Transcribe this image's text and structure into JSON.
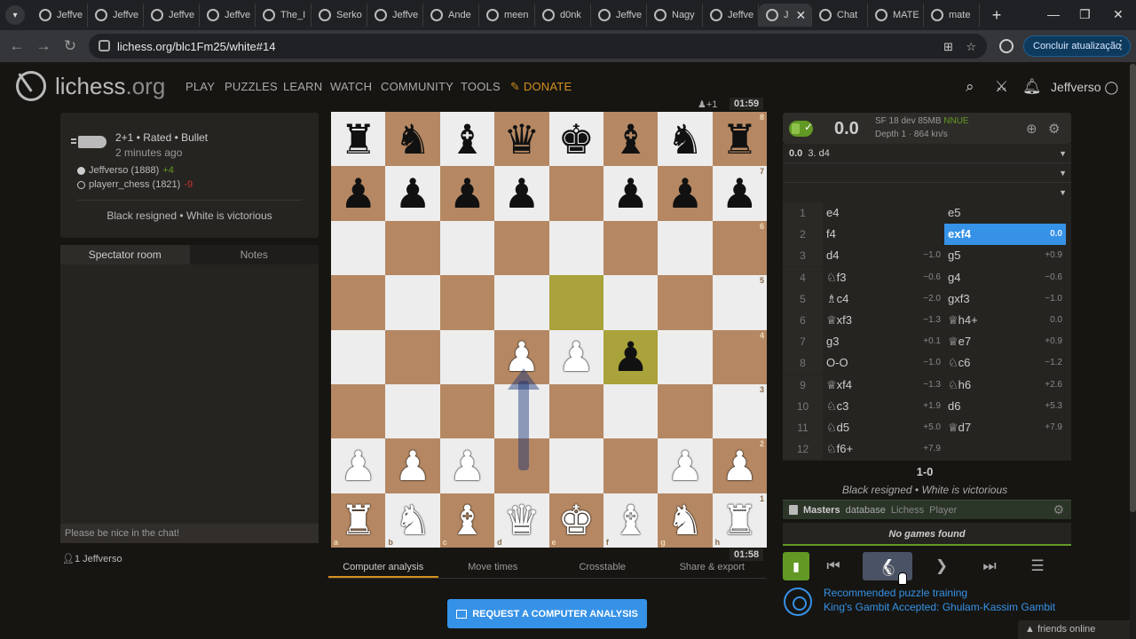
{
  "browser": {
    "tabs": [
      {
        "title": "Jeffve",
        "active": false
      },
      {
        "title": "Jeffve",
        "active": false
      },
      {
        "title": "Jeffve",
        "active": false
      },
      {
        "title": "Jeffve",
        "active": false
      },
      {
        "title": "The_I",
        "active": false
      },
      {
        "title": "Serko",
        "active": false
      },
      {
        "title": "Jeffve",
        "active": false
      },
      {
        "title": "Ande",
        "active": false
      },
      {
        "title": "meen",
        "active": false
      },
      {
        "title": "d0nk",
        "active": false
      },
      {
        "title": "Jeffve",
        "active": false
      },
      {
        "title": "Nagy",
        "active": false
      },
      {
        "title": "Jeffve",
        "active": false
      },
      {
        "title": "J",
        "active": true
      },
      {
        "title": "Chat",
        "active": false
      },
      {
        "title": "MATE",
        "active": false
      },
      {
        "title": "mate",
        "active": false
      }
    ],
    "url": "lichess.org/blc1Fm25/white#14",
    "update_button": "Concluir atualização"
  },
  "header": {
    "logo": "lichess",
    "logo_tld": ".org",
    "nav": [
      "PLAY",
      "PUZZLES",
      "LEARN",
      "WATCH",
      "COMMUNITY",
      "TOOLS"
    ],
    "donate": "DONATE",
    "username": "Jeffverso"
  },
  "game_meta": {
    "format": "2+1 • Rated • Bullet",
    "time_ago": "2 minutes ago",
    "white_player": "Jeffverso (1888)",
    "white_diff": "+4",
    "black_player": "playerr_chess (1821)",
    "black_diff": "-9",
    "result": "Black resigned • White is victorious"
  },
  "chat": {
    "tab_spectator": "Spectator room",
    "tab_notes": "Notes",
    "placeholder": "Please be nice in the chat!",
    "spectators": "1  Jeffverso"
  },
  "board": {
    "ranks": [
      [
        "r",
        "n",
        "b",
        "q",
        "k",
        "b",
        "n",
        "r"
      ],
      [
        "p",
        "p",
        "p",
        "p",
        "",
        "p",
        "p",
        "p"
      ],
      [
        "",
        "",
        "",
        "",
        "",
        "",
        "",
        ""
      ],
      [
        "",
        "",
        "",
        "",
        "",
        "",
        "",
        ""
      ],
      [
        "",
        "",
        "",
        "P",
        "P",
        "p",
        "",
        ""
      ],
      [
        "",
        "",
        "",
        "",
        "",
        "",
        "",
        ""
      ],
      [
        "P",
        "P",
        "P",
        "",
        "",
        "",
        "P",
        "P"
      ],
      [
        "R",
        "N",
        "B",
        "Q",
        "K",
        "B",
        "N",
        "R"
      ]
    ],
    "highlights": [
      "e5",
      "f4"
    ],
    "arrow": "d2-d4",
    "top_clock": "01:59",
    "bottom_clock": "01:58",
    "ply_indicator": "+1",
    "rank_labels": [
      "8",
      "7",
      "6",
      "5",
      "4",
      "3",
      "2",
      "1"
    ],
    "file_labels": [
      "a",
      "b",
      "c",
      "d",
      "e",
      "f",
      "g",
      "h"
    ]
  },
  "under_board_tabs": [
    "Computer analysis",
    "Move times",
    "Crosstable",
    "Share & export"
  ],
  "request_button": "REQUEST A COMPUTER ANALYSIS",
  "ceval": {
    "score": "0.0",
    "engine": "SF 18 dev 85MB",
    "nnue": "NNUE",
    "depth": "Depth 1 · 864 kn/s",
    "pv1_eval": "0.0",
    "pv1_line": "3. d4"
  },
  "moves": [
    {
      "n": "1",
      "w": "e4",
      "we": "",
      "b": "e5",
      "be": ""
    },
    {
      "n": "2",
      "w": "f4",
      "we": "",
      "b": "exf4",
      "be": "0.0",
      "active": true
    },
    {
      "n": "3",
      "w": "d4",
      "we": "−1.0",
      "b": "g5",
      "be": "+0.9"
    },
    {
      "n": "4",
      "w": "♘f3",
      "we": "−0.6",
      "b": "g4",
      "be": "−0.6"
    },
    {
      "n": "5",
      "w": "♗c4",
      "we": "−2.0",
      "b": "gxf3",
      "be": "−1.0"
    },
    {
      "n": "6",
      "w": "♕xf3",
      "we": "−1.3",
      "b": "♕h4+",
      "be": "0.0"
    },
    {
      "n": "7",
      "w": "g3",
      "we": "+0.1",
      "b": "♕e7",
      "be": "+0.9"
    },
    {
      "n": "8",
      "w": "O-O",
      "we": "−1.0",
      "b": "♘c6",
      "be": "−1.2"
    },
    {
      "n": "9",
      "w": "♕xf4",
      "we": "−1.3",
      "b": "♘h6",
      "be": "+2.6"
    },
    {
      "n": "10",
      "w": "♘c3",
      "we": "+1.9",
      "b": "d6",
      "be": "+5.3"
    },
    {
      "n": "11",
      "w": "♘d5",
      "we": "+5.0",
      "b": "♕d7",
      "be": "+7.9"
    },
    {
      "n": "12",
      "w": "♘f6+",
      "we": "+7.9",
      "b": "",
      "be": ""
    }
  ],
  "result_score": "1-0",
  "result_text": "Black resigned • White is victorious",
  "explorer": {
    "masters": "Masters",
    "database": "database",
    "lichess": "Lichess",
    "player": "Player",
    "no_games": "No games found"
  },
  "training": {
    "line1": "Recommended puzzle training",
    "line2": "King's Gambit Accepted: Ghulam-Kassim Gambit"
  },
  "friends": "friends online",
  "colors": {
    "accent_blue": "#3692e7",
    "green": "#629924",
    "board_light": "#ededed",
    "board_dark": "#b58863",
    "donate": "#d59020"
  }
}
